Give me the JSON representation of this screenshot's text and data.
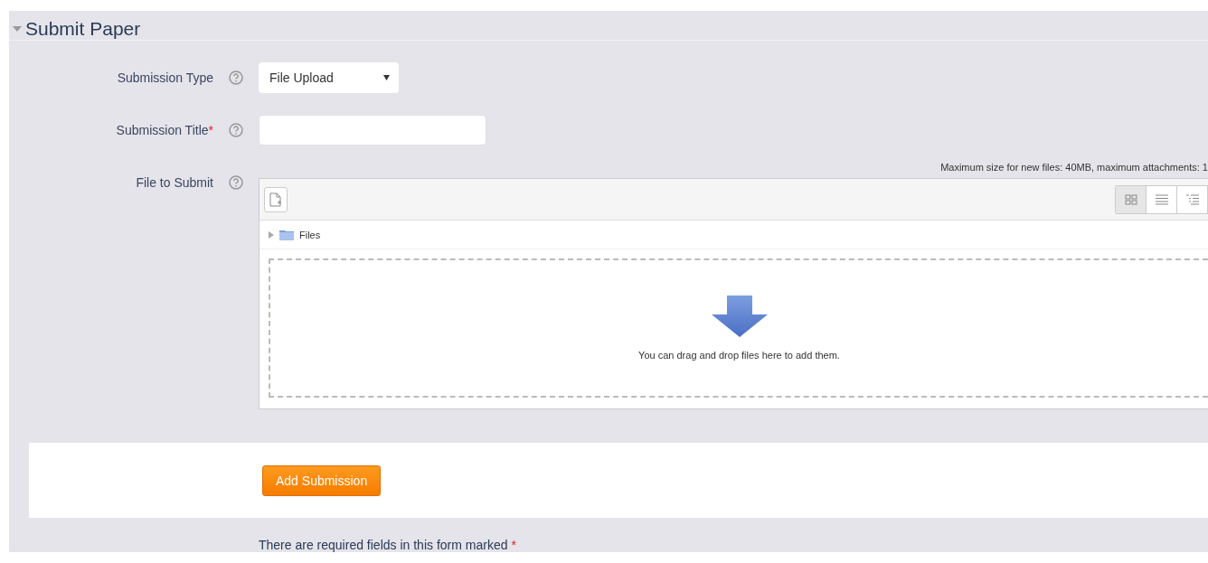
{
  "section": {
    "title": "Submit Paper",
    "expanded": true
  },
  "fields": [
    {
      "kind": "select",
      "label": "Submission Type",
      "value": "File Upload"
    },
    {
      "kind": "text",
      "label": "Submission Title",
      "required_mark": "*"
    },
    {
      "kind": "file",
      "label": "File to Submit",
      "limits": "Maximum size for new files: 40MB, maximum attachments: 1",
      "folder": "Files",
      "drop_hint": "You can drag and drop files here to add them."
    }
  ],
  "submit_button": "Add Submission",
  "required_note": "There are required fields in this form marked",
  "required_note_mark": "*"
}
